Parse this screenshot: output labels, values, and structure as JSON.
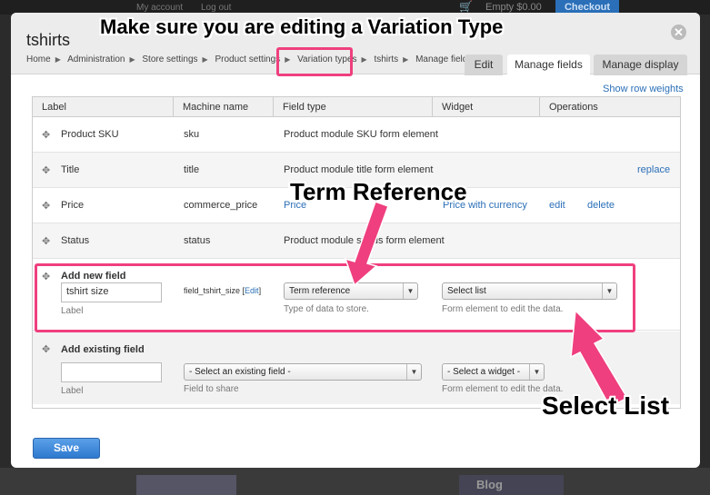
{
  "background": {
    "top_links": [
      "My account",
      "Log out"
    ],
    "cart_text": "Empty  $0.00",
    "checkout": "Checkout",
    "blog": "Blog"
  },
  "modal": {
    "title": "tshirts",
    "close": "✕",
    "breadcrumb": [
      "Home",
      "Administration",
      "Store settings",
      "Product settings",
      "Variation types",
      "tshirts",
      "Manage fields"
    ],
    "tabs": [
      "Edit",
      "Manage fields",
      "Manage display"
    ],
    "active_tab": "Manage fields",
    "show_row_weights": "Show row weights"
  },
  "table": {
    "headers": [
      "Label",
      "Machine name",
      "Field type",
      "Widget",
      "Operations"
    ],
    "rows": [
      {
        "label": "Product SKU",
        "machine": "sku",
        "type": "Product module SKU form element",
        "widget": "",
        "ops": []
      },
      {
        "label": "Title",
        "machine": "title",
        "type": "Product module title form element",
        "widget": "",
        "ops": [
          "replace"
        ]
      },
      {
        "label": "Price",
        "machine": "commerce_price",
        "type": "Price",
        "widget": "Price with currency",
        "ops": [
          "edit",
          "delete"
        ]
      },
      {
        "label": "Status",
        "machine": "status",
        "type": "Product module status form element",
        "widget": "",
        "ops": []
      }
    ],
    "add_new": {
      "heading": "Add new field",
      "label_value": "tshirt size",
      "label_hint": "Label",
      "machine_name": "field_tshirt_size",
      "edit_link": "Edit",
      "type_value": "Term reference",
      "type_hint": "Type of data to store.",
      "widget_value": "Select list",
      "widget_hint": "Form element to edit the data."
    },
    "add_existing": {
      "heading": "Add existing field",
      "label_value": "",
      "label_hint": "Label",
      "field_value": "- Select an existing field -",
      "field_hint": "Field to share",
      "widget_value": "- Select a widget -",
      "widget_hint": "Form element to edit the data."
    }
  },
  "save_label": "Save",
  "annotations": {
    "top": "Make sure you are editing a Variation Type",
    "middle": "Term Reference",
    "bottom": "Select List",
    "color": "#ef3f7e"
  }
}
